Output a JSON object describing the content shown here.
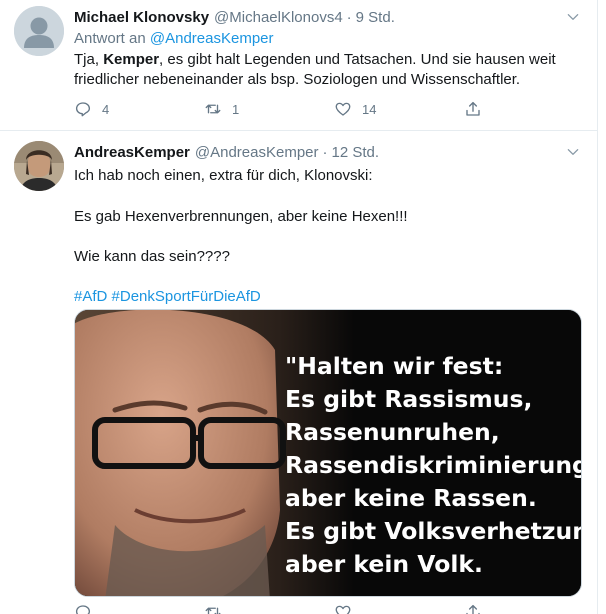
{
  "tweet1": {
    "name": "Michael Klonovsky",
    "handle": "@MichaelKlonovs4",
    "separator": "·",
    "time": "9 Std.",
    "reply_prefix": "Antwort an",
    "reply_mention": "@AndreasKemper",
    "text_start": "Tja, ",
    "text_bold": "Kemper",
    "text_end": ", es gibt halt Legenden und Tatsachen. Und sie hausen weit friedlicher nebeneinander als bsp. Soziologen und Wissenschaftler.",
    "replies": "4",
    "retweets": "1",
    "likes": "14"
  },
  "tweet2": {
    "name": "AndreasKemper",
    "handle": "@AndreasKemper",
    "separator": "·",
    "time": "12 Std.",
    "line1": "Ich hab noch einen, extra für dich, Klonovski:",
    "line2": "Es gab Hexenverbrennungen, aber keine Hexen!!!",
    "line3": "Wie kann das sein????",
    "hashtag1": "#AfD",
    "hashtag2": "#DenkSportFürDieAfD",
    "image_quote": [
      "\"Halten wir fest:",
      "Es gibt Rassismus,",
      "Rassenunruhen,",
      "Rassendiskriminierung –",
      "aber keine Rassen.",
      "Es gibt Volksverhetzung,",
      "aber kein Volk."
    ]
  },
  "icons": {
    "reply": "reply-icon",
    "retweet": "retweet-icon",
    "like": "heart-icon",
    "share": "share-icon",
    "caret": "chevron-down-icon"
  },
  "colors": {
    "link": "#1b95e0",
    "muted": "#657786",
    "text": "#14171a",
    "divider": "#e6ecf0"
  }
}
